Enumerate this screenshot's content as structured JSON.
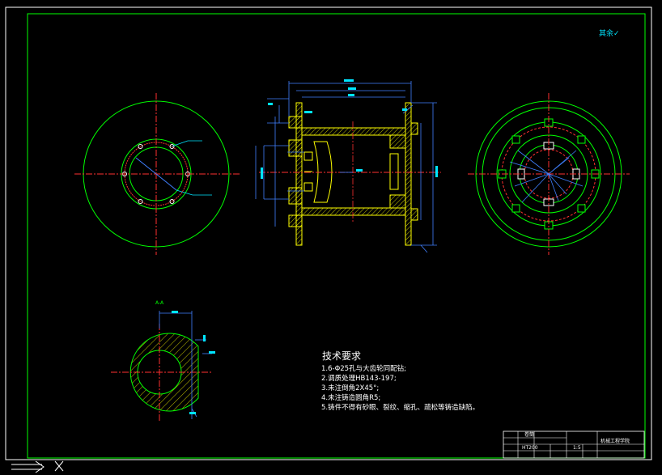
{
  "drawing": {
    "top_right_mark": "其余✓",
    "section_label": "A-A",
    "tech_requirements": {
      "title": "技术要求",
      "lines": [
        "1.6-Φ25孔与大齿轮同配钻;",
        "2.调质处理HB143-197;",
        "3.未注倒角2X45°;",
        "4.未注铸造圆角R5;",
        "5.铸件不得有砂眼、裂纹、缩孔、疏松等铸造缺陷。"
      ]
    },
    "title_block": {
      "part_name": "卷筒",
      "material": "HT200",
      "scale": "1:5",
      "company": "机械工程学院"
    }
  }
}
